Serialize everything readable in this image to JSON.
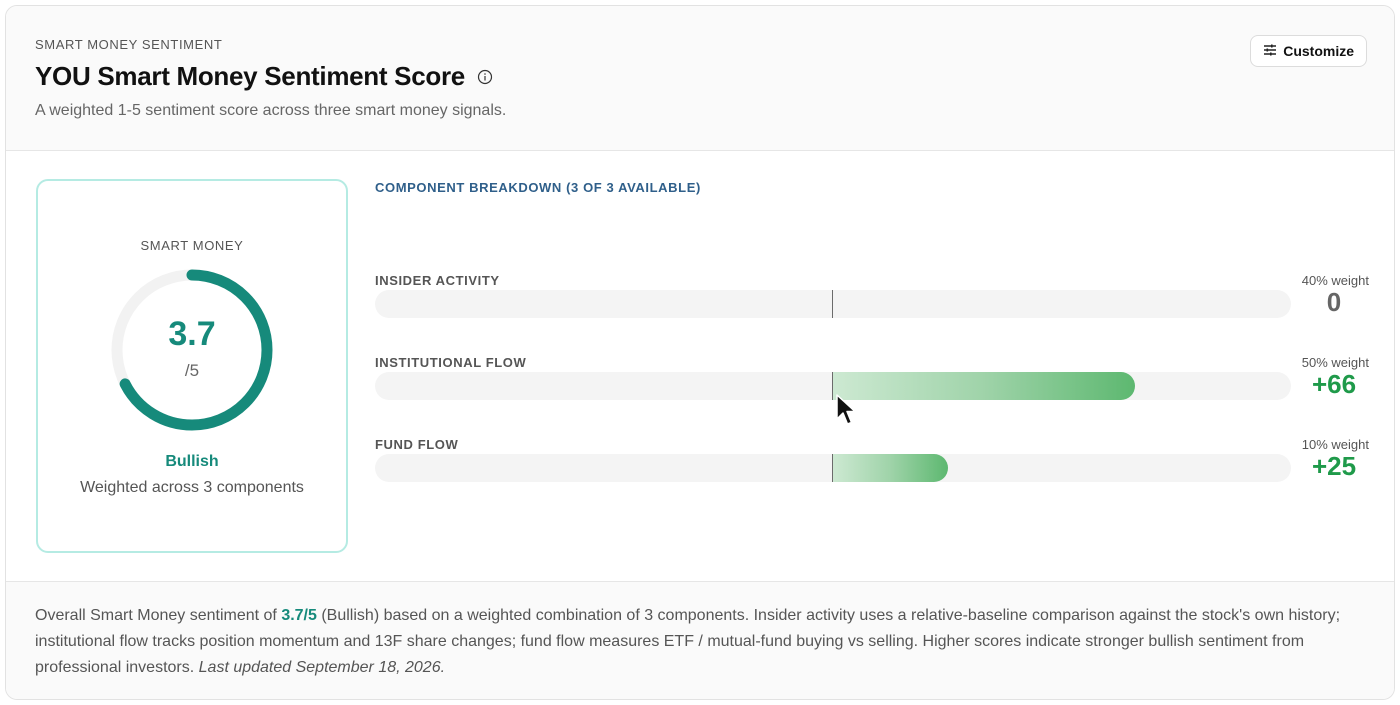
{
  "header": {
    "eyebrow": "SMART MONEY SENTIMENT",
    "title": "YOU Smart Money Sentiment Score",
    "subtitle": "A weighted 1-5 sentiment score across three smart money signals.",
    "customize_label": "Customize"
  },
  "score_card": {
    "label": "SMART MONEY",
    "score": "3.7",
    "max": "/5",
    "score_fraction": 0.675,
    "sentiment": "Bullish",
    "weighted_note": "Weighted across 3 components",
    "accent_color": "#168a7b",
    "border_color": "#b5ebe3"
  },
  "breakdown": {
    "title": "COMPONENT BREAKDOWN (3 OF 3 AVAILABLE)",
    "components": [
      {
        "name": "INSIDER ACTIVITY",
        "weight": "40% weight",
        "value": "0",
        "score": 0,
        "color": "#666666"
      },
      {
        "name": "INSTITUTIONAL FLOW",
        "weight": "50% weight",
        "value": "+66",
        "score": 66,
        "color": "#1f9a4a"
      },
      {
        "name": "FUND FLOW",
        "weight": "10% weight",
        "value": "+25",
        "score": 25,
        "color": "#1f9a4a"
      }
    ]
  },
  "footer": {
    "intro": "Overall Smart Money sentiment of ",
    "score_text": "3.7/5",
    "body": " (Bullish) based on a weighted combination of 3 components. Insider activity uses a relative-baseline comparison against the stock's own history; institutional flow tracks position momentum and 13F share changes; fund flow measures ETF / mutual-fund buying vs selling. Higher scores indicate stronger bullish sentiment from professional investors. ",
    "updated": "Last updated September 18, 2026."
  }
}
